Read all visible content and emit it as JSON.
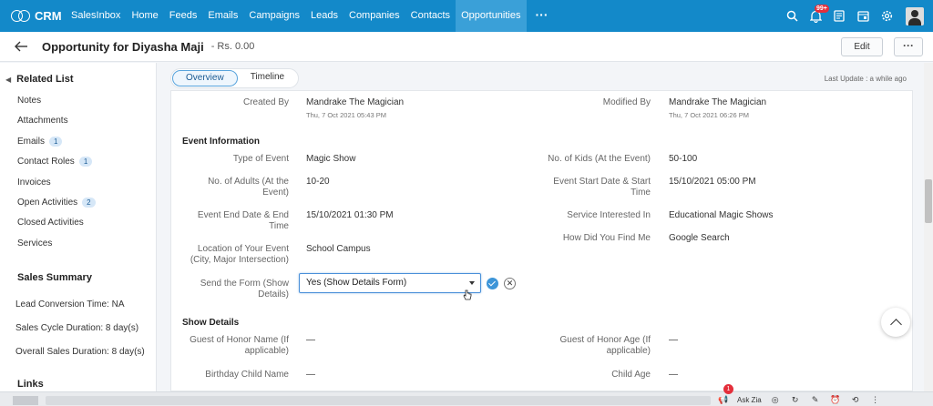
{
  "app": {
    "logo_text": "CRM"
  },
  "nav": {
    "items": [
      {
        "label": "SalesInbox"
      },
      {
        "label": "Home"
      },
      {
        "label": "Feeds"
      },
      {
        "label": "Emails"
      },
      {
        "label": "Campaigns"
      },
      {
        "label": "Leads"
      },
      {
        "label": "Companies"
      },
      {
        "label": "Contacts"
      },
      {
        "label": "Opportunities"
      }
    ],
    "more": "···",
    "notification_count": "99+",
    "icons": [
      "search-icon",
      "bell-icon",
      "calendar-icon",
      "gear-icon",
      "avatar"
    ]
  },
  "header": {
    "title": "Opportunity for Diyasha Maji",
    "amount": "- Rs. 0.00",
    "edit_label": "Edit",
    "more_label": "···"
  },
  "sidebar": {
    "related_title": "Related List",
    "items": [
      {
        "label": "Notes",
        "count": ""
      },
      {
        "label": "Attachments",
        "count": ""
      },
      {
        "label": "Emails",
        "count": "1"
      },
      {
        "label": "Contact Roles",
        "count": "1"
      },
      {
        "label": "Invoices",
        "count": ""
      },
      {
        "label": "Open Activities",
        "count": "2"
      },
      {
        "label": "Closed Activities",
        "count": ""
      },
      {
        "label": "Services",
        "count": ""
      }
    ],
    "sales_title": "Sales Summary",
    "sales_items": [
      {
        "label": "Lead Conversion Time: NA"
      },
      {
        "label": "Sales Cycle Duration: 8 day(s)"
      },
      {
        "label": "Overall Sales Duration: 8 day(s)"
      }
    ],
    "links_title": "Links"
  },
  "tabs": [
    {
      "label": "Overview",
      "active": true
    },
    {
      "label": "Timeline",
      "active": false
    }
  ],
  "last_update": "Last Update : a while ago",
  "record": {
    "created_by_label": "Created By",
    "created_by": "Mandrake The Magician",
    "created_on": "Thu, 7 Oct 2021 05:43 PM",
    "modified_by_label": "Modified By",
    "modified_by": "Mandrake The Magician",
    "modified_on": "Thu, 7 Oct 2021 06:26 PM"
  },
  "event_section": "Event Information",
  "event_fields": {
    "type_label": "Type of Event",
    "type": "Magic Show",
    "kids_label": "No. of Kids (At the Event)",
    "kids": "50-100",
    "adults_label1": "No. of Adults (At the",
    "adults_label2": "Event)",
    "adults": "10-20",
    "start_label1": "Event Start Date & Start",
    "start_label2": "Time",
    "start": "15/10/2021 05:00 PM",
    "end_label1": "Event End Date & End",
    "end_label2": "Time",
    "end": "15/10/2021 01:30 PM",
    "service_label": "Service Interested In",
    "service": "Educational Magic Shows",
    "found_label": "How Did You Find Me",
    "found": "Google Search",
    "location_label1": "Location of Your Event",
    "location_label2": "(City, Major Intersection)",
    "location": "School Campus",
    "send_label1": "Send the Form (Show",
    "send_label2": "Details)",
    "send_value": "Yes (Show Details Form)"
  },
  "show_section": "Show Details",
  "show_fields": {
    "honor_name_label1": "Guest of Honor Name (If",
    "honor_name_label2": "applicable)",
    "honor_name": "—",
    "honor_age_label1": "Guest of Honor Age (If",
    "honor_age_label2": "applicable)",
    "honor_age": "—",
    "bday_label": "Birthday Child Name",
    "bday": "—",
    "child_age_label": "Child Age",
    "child_age": "—"
  },
  "bottom": {
    "zia_label": "Ask Zia",
    "notif_count": "1"
  }
}
